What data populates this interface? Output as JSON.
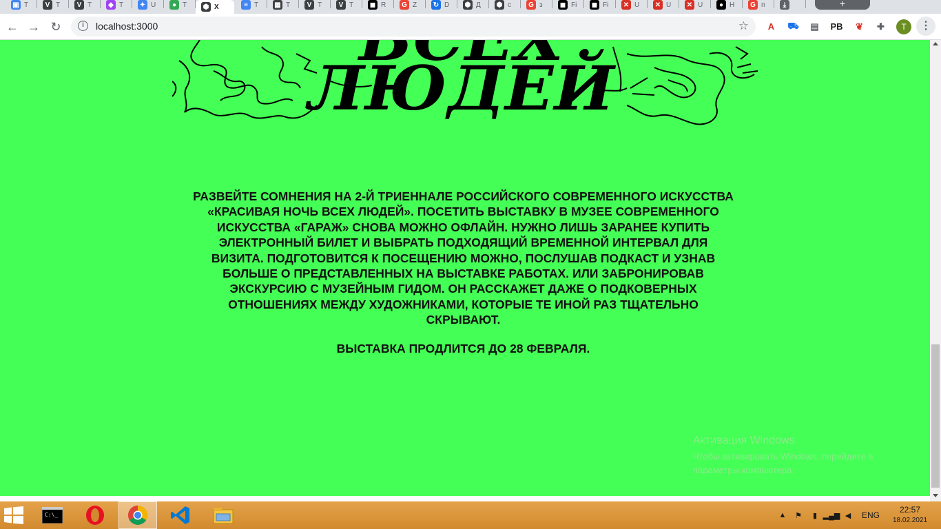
{
  "browser": {
    "tabs": [
      {
        "title": "Т",
        "favicon_color": "#4285f4",
        "favicon_glyph": "▣"
      },
      {
        "title": "Т",
        "favicon_color": "#3c4043",
        "favicon_glyph": "V"
      },
      {
        "title": "Т",
        "favicon_color": "#3c4043",
        "favicon_glyph": "V"
      },
      {
        "title": "Т",
        "favicon_color": "#a142f4",
        "favicon_glyph": "◆"
      },
      {
        "title": "U",
        "favicon_color": "#4285f4",
        "favicon_glyph": "✦"
      },
      {
        "title": "Т",
        "favicon_color": "#34a853",
        "favicon_glyph": "●"
      },
      {
        "title": "Х",
        "favicon_color": "#3c4043",
        "favicon_glyph": "⬢",
        "active": true
      },
      {
        "title": "Т",
        "favicon_color": "#4285f4",
        "favicon_glyph": "≡"
      },
      {
        "title": "Т",
        "favicon_color": "#3c4043",
        "favicon_glyph": "▦"
      },
      {
        "title": "Т",
        "favicon_color": "#3c4043",
        "favicon_glyph": "V"
      },
      {
        "title": "Т",
        "favicon_color": "#3c4043",
        "favicon_glyph": "V"
      },
      {
        "title": "R",
        "favicon_color": "#000000",
        "favicon_glyph": "◼"
      },
      {
        "title": "Z",
        "favicon_color": "#ea4335",
        "favicon_glyph": "G"
      },
      {
        "title": "D",
        "favicon_color": "#1a73e8",
        "favicon_glyph": "↻"
      },
      {
        "title": "Д",
        "favicon_color": "#3c4043",
        "favicon_glyph": "⬢"
      },
      {
        "title": "c",
        "favicon_color": "#3c4043",
        "favicon_glyph": "⬢"
      },
      {
        "title": "з",
        "favicon_color": "#ea4335",
        "favicon_glyph": "G"
      },
      {
        "title": "Fi",
        "favicon_color": "#000000",
        "favicon_glyph": "◼"
      },
      {
        "title": "Fi",
        "favicon_color": "#000000",
        "favicon_glyph": "◼"
      },
      {
        "title": "U",
        "favicon_color": "#d93025",
        "favicon_glyph": "✕"
      },
      {
        "title": "U",
        "favicon_color": "#d93025",
        "favicon_glyph": "✕"
      },
      {
        "title": "U",
        "favicon_color": "#d93025",
        "favicon_glyph": "✕"
      },
      {
        "title": "H",
        "favicon_color": "#000000",
        "favicon_glyph": "●"
      },
      {
        "title": "п",
        "favicon_color": "#ea4335",
        "favicon_glyph": "G"
      },
      {
        "title": "",
        "favicon_color": "#5f6368",
        "favicon_glyph": "⤓"
      }
    ],
    "new_tab_label": "+",
    "url": "localhost:3000",
    "profile_initial": "T",
    "extensions": [
      {
        "name": "pdf",
        "glyph": "A",
        "color": "#d93025"
      },
      {
        "name": "car",
        "glyph": "⛟",
        "color": "#1a73e8"
      },
      {
        "name": "store",
        "glyph": "▤",
        "color": "#5f6368"
      },
      {
        "name": "pb",
        "glyph": "PB",
        "color": "#202124"
      },
      {
        "name": "pepper",
        "glyph": "❦",
        "color": "#d93025"
      },
      {
        "name": "puzzle",
        "glyph": "✚",
        "color": "#5f6368"
      }
    ]
  },
  "page": {
    "background": "#44ff55",
    "hero_title_line1": "ВСЕХ",
    "hero_title_line2": "ЛЮДЕЙ",
    "description": "Развейте сомнения на 2-й Триеннале российского современного искусства «Красивая ночь всех людей». Посетить выставку в Музее современного искусства «Гараж» снова можно офлайн. Нужно лишь заранее купить электронный билет и выбрать подходящий временной интервал для визита. Подготовится к посещению можно, послушав подкаст и узнав больше о представленных на выставке работах. Или забронировав экскурсию с музейным гидом. Он расскажет даже о подковерных отношениях между художниками, которые те иной раз тщательно скрывают.",
    "closing": "ВЫСТАВКА ПРОДЛИТСЯ ДО 28 ФЕВРАЛЯ."
  },
  "watermark": {
    "title": "Активация Windows",
    "line1": "Чтобы активировать Windows, перейдите в",
    "line2": "параметры компьютера."
  },
  "taskbar": {
    "apps": [
      "cmd",
      "opera",
      "chrome",
      "vscode",
      "explorer"
    ],
    "language": "ENG",
    "time": "22:57",
    "date": "18.02.2021"
  }
}
